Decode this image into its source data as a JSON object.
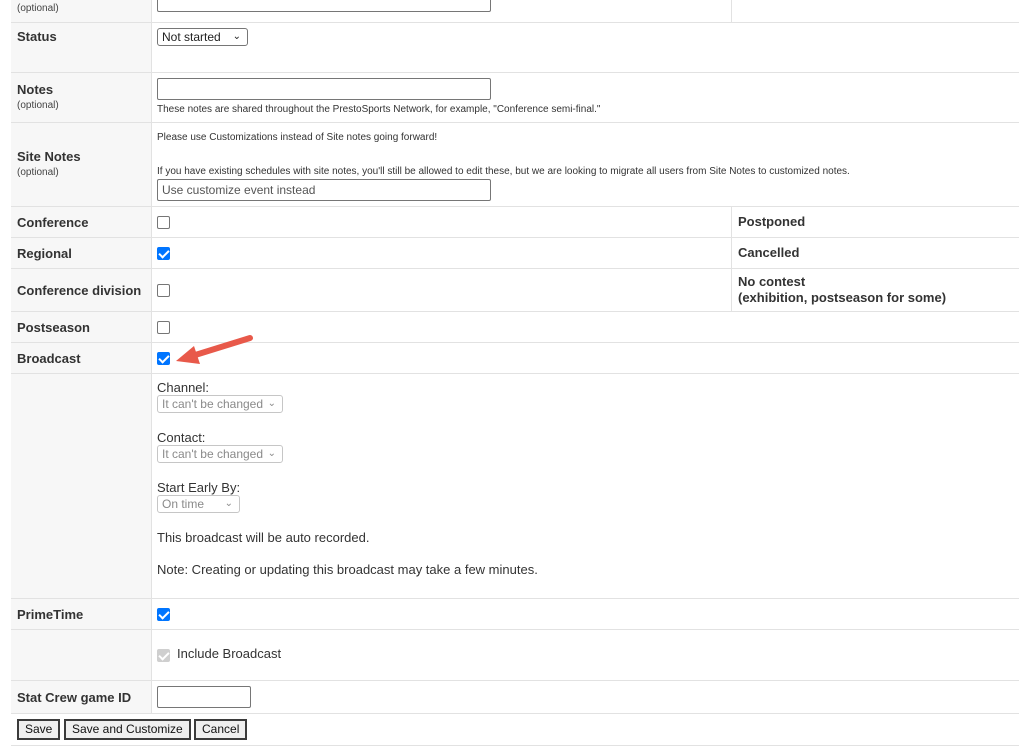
{
  "rows": {
    "top": {
      "optional": "(optional)"
    },
    "status": {
      "label": "Status",
      "value": "Not started"
    },
    "notes": {
      "label": "Notes",
      "optional": "(optional)",
      "help": "These notes are shared throughout the PrestoSports Network, for example, \"Conference semi-final.\""
    },
    "site_notes": {
      "label": "Site Notes",
      "optional": "(optional)",
      "msg1": "Please use Customizations instead of Site notes going forward!",
      "msg2": "If you have existing schedules with site notes, you'll still be allowed to edit these, but we are looking to migrate all users from Site Notes to customized notes.",
      "value": "Use customize event instead"
    },
    "conference": {
      "label": "Conference",
      "checked": false
    },
    "regional": {
      "label": "Regional",
      "checked": true
    },
    "conference_division": {
      "label": "Conference division",
      "checked": false
    },
    "postseason": {
      "label": "Postseason",
      "checked": false
    },
    "broadcast": {
      "label": "Broadcast",
      "checked": true
    },
    "primetime": {
      "label": "PrimeTime",
      "checked": true
    },
    "stat_crew": {
      "label": "Stat Crew game ID",
      "value": ""
    }
  },
  "right_column": {
    "postponed": "Postponed",
    "cancelled": "Cancelled",
    "no_contest_1": "No contest",
    "no_contest_2": "(exhibition, postseason for some)"
  },
  "broadcast_details": {
    "channel_label": "Channel:",
    "channel_value": "It can't be changed",
    "contact_label": "Contact:",
    "contact_value": "It can't be changed",
    "start_early_label": "Start Early By:",
    "start_early_value": "On time",
    "auto_recorded": "This broadcast will be auto recorded.",
    "note": "Note: Creating or updating this broadcast may take a few minutes."
  },
  "include_broadcast": {
    "label": "Include Broadcast",
    "checked": true,
    "disabled": true
  },
  "buttons": {
    "save": "Save",
    "save_customize": "Save and Customize",
    "cancel": "Cancel"
  },
  "annotation": {
    "arrow_color": "#e8594a"
  },
  "colors": {
    "checkbox_accent": "#0075ff",
    "label_bg": "#f7f7f7",
    "border": "#e2e2e2"
  }
}
